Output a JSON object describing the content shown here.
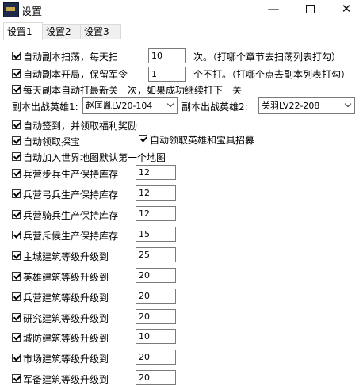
{
  "window": {
    "title": "设置"
  },
  "tabs": [
    "设置1",
    "设置2",
    "设置3"
  ],
  "dungeon": {
    "sweep_label": "自动副本扫荡，每天扫",
    "sweep_value": "10",
    "sweep_note": "次。（打哪个章节去扫荡列表打勾）",
    "open_label": "自动副本开局，保留军令",
    "open_value": "1",
    "open_note": "个不打。（打哪个点去副本列表打勾）",
    "daily_label": "每天副本自动打最新关一次，如果成功继续打下一关",
    "hero1_label": "副本出战英雄1:",
    "hero1_value": "赵匡胤LV20-104",
    "hero2_label": "副本出战英雄2:",
    "hero2_value": "关羽LV22-208"
  },
  "misc": {
    "signin_label": "自动签到，并领取福利奖励",
    "treasure_label": "自动领取探宝",
    "hero_recruit_label": "自动领取英雄和宝具招募",
    "worldmap_label": "自动加入世界地图默认第一个地图"
  },
  "barracks": [
    {
      "label": "兵营步兵生产保持库存",
      "value": "12"
    },
    {
      "label": "兵营弓兵生产保持库存",
      "value": "12"
    },
    {
      "label": "兵营骑兵生产保持库存",
      "value": "12"
    },
    {
      "label": "兵营斥候生产保持库存",
      "value": "15"
    }
  ],
  "buildings": [
    {
      "label": "主城建筑等级升级到",
      "value": "25"
    },
    {
      "label": "英雄建筑等级升级到",
      "value": "20"
    },
    {
      "label": "兵营建筑等级升级到",
      "value": "20"
    },
    {
      "label": "研究建筑等级升级到",
      "value": "20"
    },
    {
      "label": "城防建筑等级升级到",
      "value": "10"
    },
    {
      "label": "市场建筑等级升级到",
      "value": "20"
    },
    {
      "label": "军备建筑等级升级到",
      "value": "20"
    }
  ]
}
